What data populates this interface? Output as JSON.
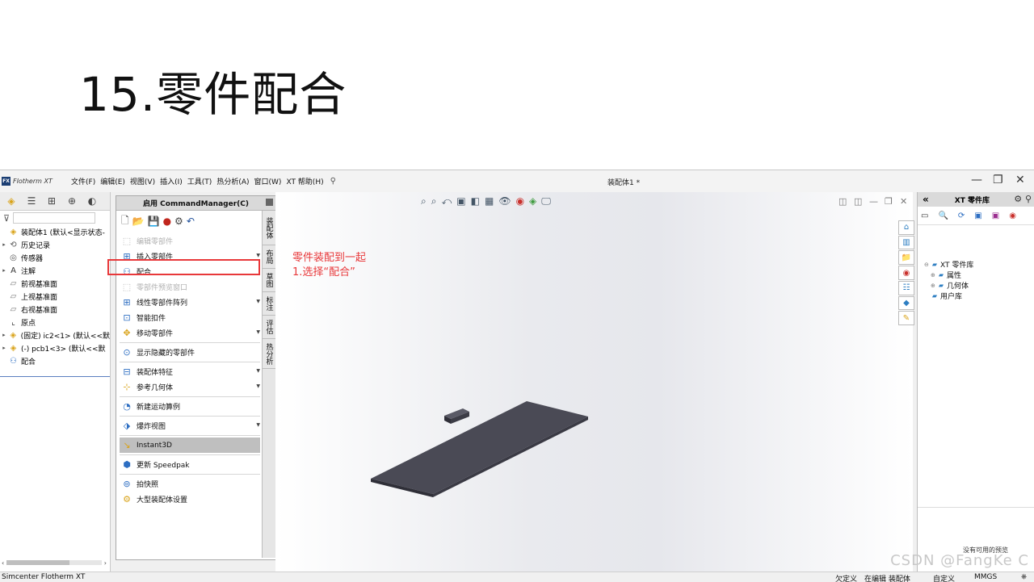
{
  "slide": {
    "title": "15.零件配合"
  },
  "app": {
    "name": "Flotherm XT",
    "menu": [
      "文件(F)",
      "编辑(E)",
      "视图(V)",
      "插入(I)",
      "工具(T)",
      "热分析(A)",
      "窗口(W)",
      "XT 帮助(H)"
    ],
    "document_title": "装配体1 *"
  },
  "feature_tree": {
    "items": [
      {
        "label": "装配体1 (默认<显示状态-",
        "expand": "",
        "icon": "assembly-icon"
      },
      {
        "label": "历史记录",
        "expand": "▸",
        "icon": "history-icon"
      },
      {
        "label": "传感器",
        "expand": "",
        "icon": "sensor-icon"
      },
      {
        "label": "注解",
        "expand": "▸",
        "icon": "annotation-icon"
      },
      {
        "label": "前视基准面",
        "expand": "",
        "icon": "plane-icon"
      },
      {
        "label": "上视基准面",
        "expand": "",
        "icon": "plane-icon"
      },
      {
        "label": "右视基准面",
        "expand": "",
        "icon": "plane-icon"
      },
      {
        "label": "原点",
        "expand": "",
        "icon": "origin-icon"
      },
      {
        "label": "(固定) ic2<1> (默认<<默",
        "expand": "▸",
        "icon": "part-icon"
      },
      {
        "label": "(-) pcb1<3> (默认<<默",
        "expand": "▸",
        "icon": "part-icon"
      },
      {
        "label": "配合",
        "expand": "",
        "icon": "mates-icon"
      }
    ]
  },
  "command_manager": {
    "header": "启用 CommandManager(C)",
    "items": [
      {
        "label": "编辑零部件",
        "disabled": true,
        "dropdown": false
      },
      {
        "label": "插入零部件",
        "disabled": false,
        "dropdown": true
      },
      {
        "label": "配合",
        "disabled": false,
        "dropdown": false
      },
      {
        "label": "零部件预览窗口",
        "disabled": true,
        "dropdown": false
      },
      {
        "label": "线性零部件阵列",
        "disabled": false,
        "dropdown": true
      },
      {
        "label": "智能扣件",
        "disabled": false,
        "dropdown": false
      },
      {
        "label": "移动零部件",
        "disabled": false,
        "dropdown": true
      },
      {
        "label": "显示隐藏的零部件",
        "disabled": false,
        "dropdown": false
      },
      {
        "label": "装配体特征",
        "disabled": false,
        "dropdown": true
      },
      {
        "label": "参考几何体",
        "disabled": false,
        "dropdown": true
      },
      {
        "label": "新建运动算例",
        "disabled": false,
        "dropdown": false
      },
      {
        "label": "爆炸视图",
        "disabled": false,
        "dropdown": true
      },
      {
        "label": "Instant3D",
        "disabled": false,
        "dropdown": false,
        "selected": true
      },
      {
        "label": "更新 Speedpak",
        "disabled": false,
        "dropdown": false
      },
      {
        "label": "拍快照",
        "disabled": false,
        "dropdown": false
      },
      {
        "label": "大型装配体设置",
        "disabled": false,
        "dropdown": false
      }
    ],
    "side_tabs": [
      "装配体",
      "布局",
      "草图",
      "标注",
      "评估",
      "热分析"
    ]
  },
  "annotation": {
    "line1": "零件装配到一起",
    "line2": "1.选择“配合”"
  },
  "right_panel": {
    "title": "XT 零件库",
    "tree": [
      {
        "label": "XT 零件库",
        "indent": 0,
        "expand": "⊖"
      },
      {
        "label": "属性",
        "indent": 1,
        "expand": "⊕"
      },
      {
        "label": "几何体",
        "indent": 1,
        "expand": "⊕"
      },
      {
        "label": "用户库",
        "indent": 0,
        "expand": ""
      }
    ],
    "preview_text": "没有可用的预览"
  },
  "status": {
    "app_name": "Simcenter Flotherm XT",
    "underdefined": "欠定义",
    "editing": "在编辑 装配体",
    "custom": "自定义",
    "units": "MMGS"
  },
  "watermark": "CSDN @FangKe C",
  "colors": {
    "highlight": "#e8383a",
    "part_fill": "#4a4a55"
  }
}
